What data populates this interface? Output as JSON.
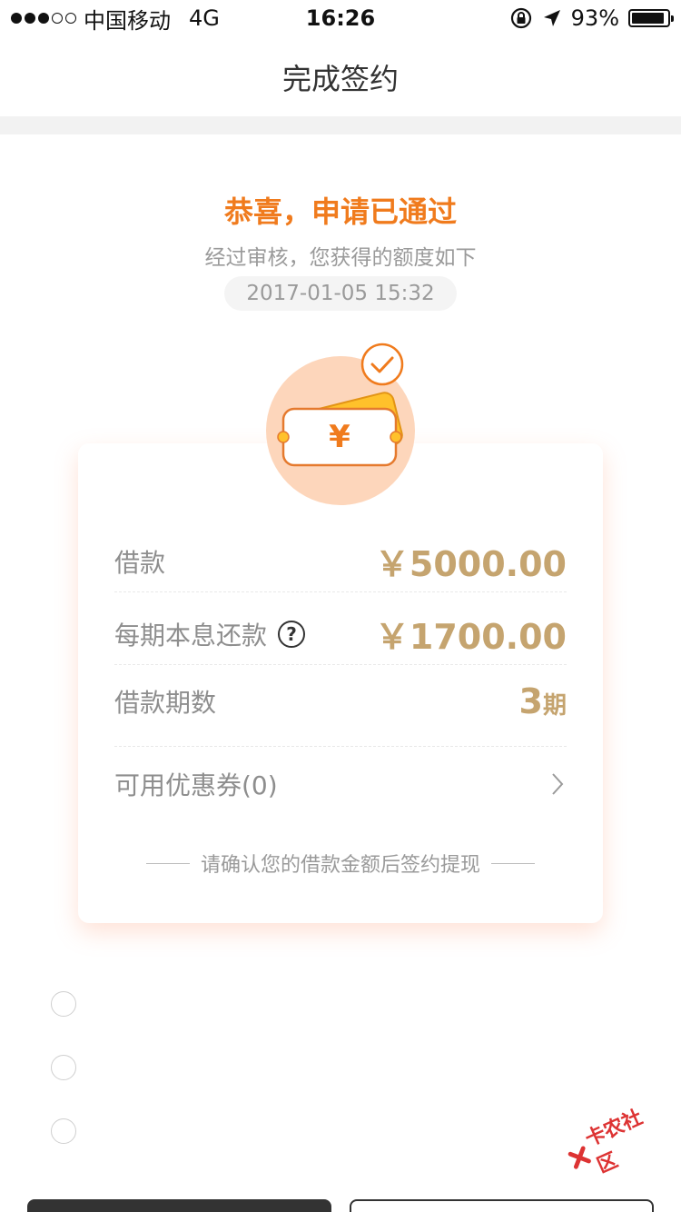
{
  "status_bar": {
    "carrier": "中国移动",
    "network": "4G",
    "time": "16:26",
    "battery": "93%",
    "battery_level": 0.93
  },
  "nav": {
    "title": "完成签约"
  },
  "header": {
    "congrats": "恭喜，申请已通过",
    "subtitle": "经过审核，您获得的额度如下",
    "timestamp": "2017-01-05 15:32"
  },
  "card": {
    "currency_symbol": "¥",
    "rows": [
      {
        "label": "借款",
        "value": "￥5000.00"
      },
      {
        "label": "每期本息还款",
        "value": "￥1700.00"
      },
      {
        "label": "借款期数",
        "value_number": "3",
        "value_unit": "期"
      },
      {
        "label": "可用优惠券(0)"
      }
    ],
    "confirm_note": "请确认您的借款金额后签约提现"
  },
  "watermark": {
    "text": "卡农社区"
  },
  "colors": {
    "accent_orange": "#f07b1d",
    "gold": "#c5a46f",
    "muted_text": "#9a9a9a",
    "illus_bg": "#fdd6bb"
  }
}
